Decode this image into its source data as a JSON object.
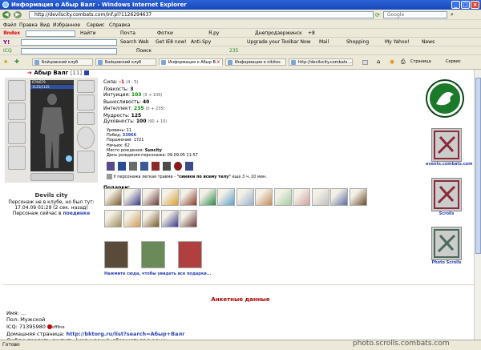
{
  "window": {
    "title": "Информация о Абыр Валг - Windows Internet Explorer"
  },
  "browser": {
    "address": "http://devilscity.combats.com/inf.pl?1126294637",
    "menu": [
      "Файл",
      "Правка",
      "Вид",
      "Избранное",
      "Сервис",
      "Справка"
    ],
    "yandex_toolbar": [
      "Яndex",
      "Найти",
      "Почта",
      "Фотки",
      "Я.ру",
      "Днепродзержинск",
      "+8"
    ],
    "toolbar2": [
      "Search Web",
      "Get IE8 now!",
      "Anti-Spy",
      "Upgrade your Toolbar Now",
      "Mail",
      "Shopping",
      "My Yahoo!",
      "News"
    ],
    "toolbar3": [
      "ICQ",
      "Поиск",
      "235"
    ],
    "tabs": [
      "Бойцовский клуб",
      "Бойцовский клуб",
      "Информация о Абыр В...",
      "Информация о nikitos",
      "http://devilscity.combats...."
    ],
    "page_menu": [
      "Страница",
      "Сервис"
    ],
    "status": "Готово"
  },
  "character": {
    "name": "Абыр Валг",
    "level": "[11]",
    "hp": "679/679",
    "mana": "1125/1125",
    "city": "Devils city",
    "status_line1": "Персонаж не в клубе, но был тут:",
    "status_line2": "17.04.09 01:29 (2 сек. назад)",
    "location_prefix": "Персонаж сейчас в",
    "location": "поединке"
  },
  "stats": [
    {
      "label": "Сила:",
      "value": "-1",
      "extra": "(4 - 5)"
    },
    {
      "label": "Ловкость:",
      "value": "3",
      "extra": ""
    },
    {
      "label": "Интуиция:",
      "value": "103",
      "extra": "(3 + 100)"
    },
    {
      "label": "Выносливость:",
      "value": "40",
      "extra": ""
    },
    {
      "label": "Интеллект:",
      "value": "235",
      "extra": "(0 + 235)"
    },
    {
      "label": "Мудрость:",
      "value": "125",
      "extra": ""
    },
    {
      "label": "Духовность:",
      "value": "100",
      "extra": "(90 + 10)"
    }
  ],
  "record": [
    {
      "label": "Уровень:",
      "value": "11"
    },
    {
      "label": "Побед:",
      "value": "33966"
    },
    {
      "label": "Поражений:",
      "value": "1721"
    },
    {
      "label": "Ничьих:",
      "value": "62"
    },
    {
      "label": "Место рождения:",
      "value": "Suncity"
    },
    {
      "label": "День рождения персонажа:",
      "value": "09.09.05 11:57"
    }
  ],
  "trauma": {
    "prefix": "У персонажа легкая травма -",
    "name": "\"синяки по всему телу\"",
    "suffix": "еще 3 ч. 10 мин."
  },
  "gifts": {
    "title": "Подарки:",
    "link": "Нажмите сюда, чтобы увидеть все подарки..."
  },
  "sidebar": [
    {
      "label": "events.combats.com",
      "color": "#1a7a2a"
    },
    {
      "label": "Scrolls",
      "color": "#8a2a3a"
    },
    {
      "label": "Photo Scrolls",
      "color": "#4a6a5a"
    }
  ],
  "profile": {
    "heading": "Анкетные данные",
    "name_label": "Имя:",
    "name_value": "...",
    "gender_label": "Пол:",
    "gender_value": "Мужской",
    "icq_label": "ICQ:",
    "icq_value": "71395980",
    "offline": "offline",
    "homepage_label": "Домашняя страница:",
    "homepage_value": "http://bktorg.ru/list?search=Абыр+Валг",
    "extra": "Люблю продать скупить (маг и воин), обращаться в аську"
  },
  "watermark": "photo.scrolls.combats.com"
}
